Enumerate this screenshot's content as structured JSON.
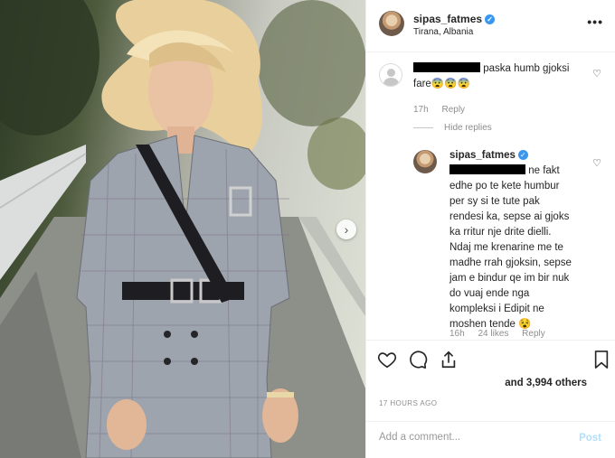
{
  "post": {
    "username": "sipas_fatmes",
    "location": "Tirana, Albania",
    "more_label": "•••",
    "next_label": "›"
  },
  "comments": [
    {
      "text_line1": "paska humb gjoksi",
      "text_line2": "fare😨😨😨",
      "time": "17h",
      "reply_label": "Reply",
      "hide_replies_label": "Hide replies"
    }
  ],
  "reply": {
    "username": "sipas_fatmes",
    "lines": [
      "ne fakt",
      "edhe po te kete humbur",
      "per sy si te tute pak",
      "rendesi ka, sepse ai gjoks",
      "ka rritur nje drite dielli.",
      "Ndaj me krenarine me te",
      "madhe rrah gjoksin, sepse",
      "jam e bindur qe im bir nuk",
      "do vuaj ende nga",
      "kompleksi i Edipit ne",
      "moshen tende 😵"
    ],
    "time": "16h",
    "likes": "24 likes",
    "reply_label": "Reply"
  },
  "likes_text": "and 3,994 others",
  "timestamp": "17 HOURS AGO",
  "add_comment": {
    "placeholder": "Add a comment...",
    "post_label": "Post"
  },
  "colors": {
    "verified": "#3897f0",
    "post_disabled": "#b2dffc",
    "meta_gray": "#8e8e8e"
  },
  "icons": [
    "heart-icon",
    "comment-icon",
    "share-icon",
    "bookmark-icon",
    "verified-badge-icon"
  ]
}
